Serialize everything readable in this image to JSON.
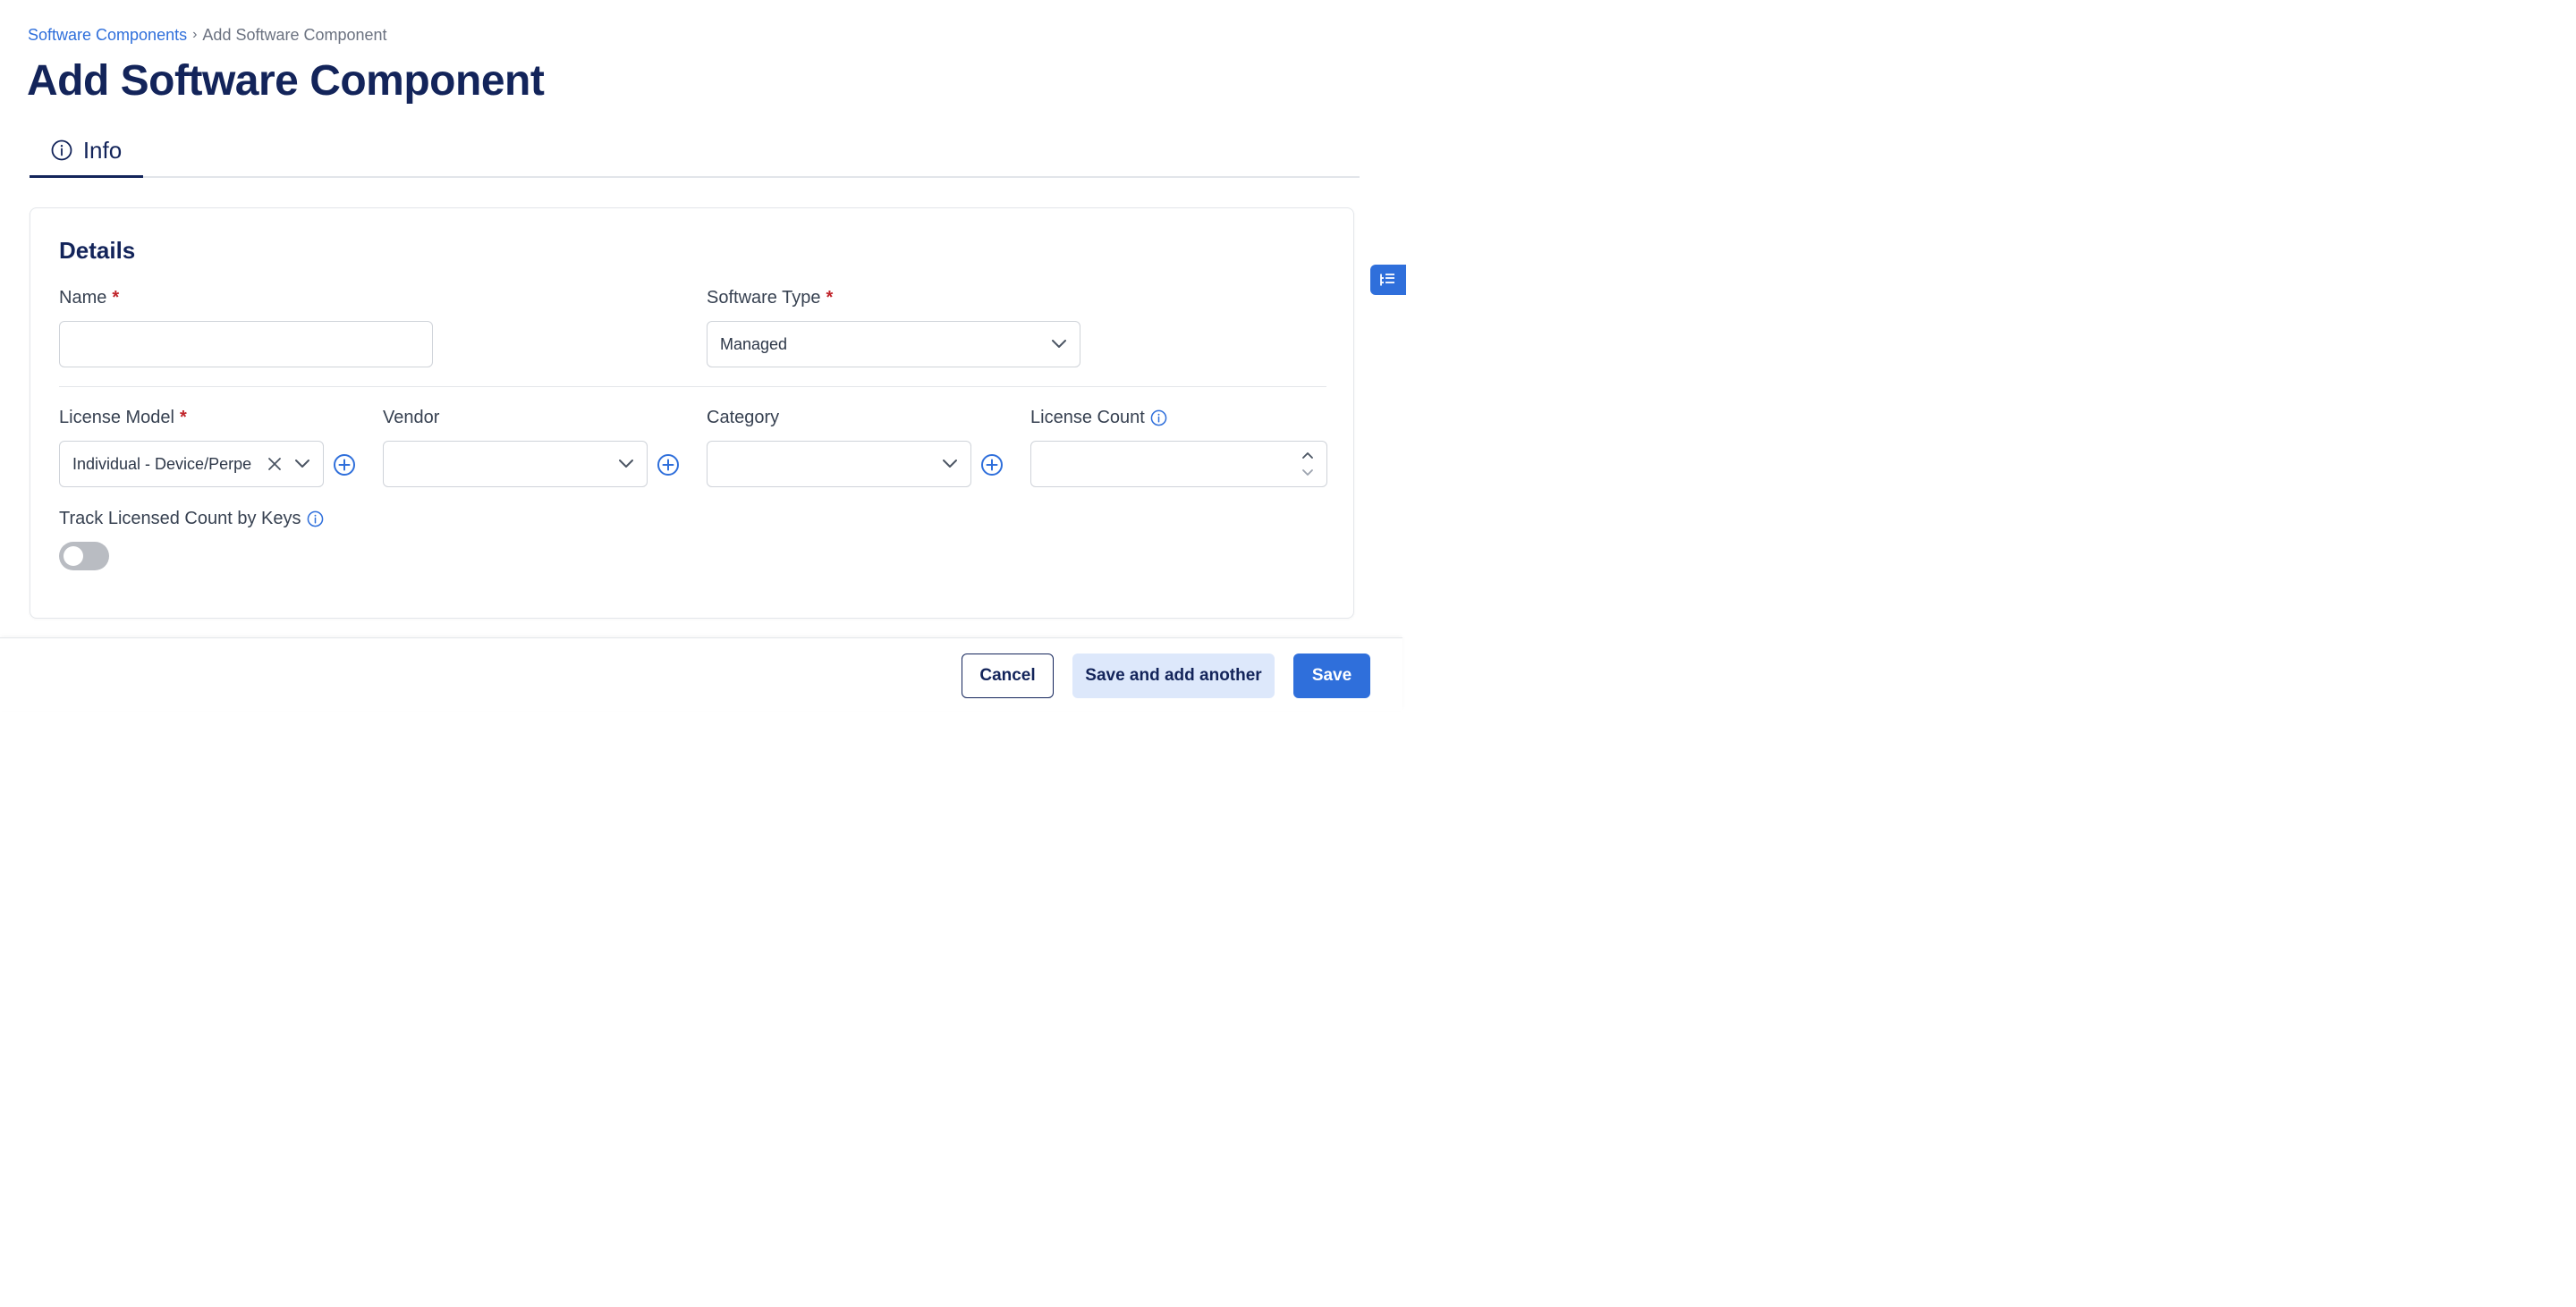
{
  "breadcrumb": {
    "parent": "Software Components",
    "separator": "›",
    "current": "Add Software Component"
  },
  "page_title": "Add Software Component",
  "tabs": [
    {
      "label": "Info",
      "icon": "info-circle-icon",
      "active": true
    }
  ],
  "details": {
    "title": "Details",
    "name": {
      "label": "Name",
      "required": "*",
      "value": ""
    },
    "software_type": {
      "label": "Software Type",
      "required": "*",
      "value": "Managed"
    },
    "license_model": {
      "label": "License Model",
      "required": "*",
      "value": "Individual - Device/Perpe"
    },
    "vendor": {
      "label": "Vendor",
      "value": ""
    },
    "category": {
      "label": "Category",
      "value": ""
    },
    "license_count": {
      "label": "License Count",
      "value": ""
    },
    "track_by_keys": {
      "label": "Track Licensed Count by Keys",
      "enabled": false
    }
  },
  "footer": {
    "cancel": "Cancel",
    "save_add_another": "Save and add another",
    "save": "Save"
  },
  "colors": {
    "primary": "#2f6fdb",
    "navy": "#13245a",
    "required": "#c0242a"
  }
}
